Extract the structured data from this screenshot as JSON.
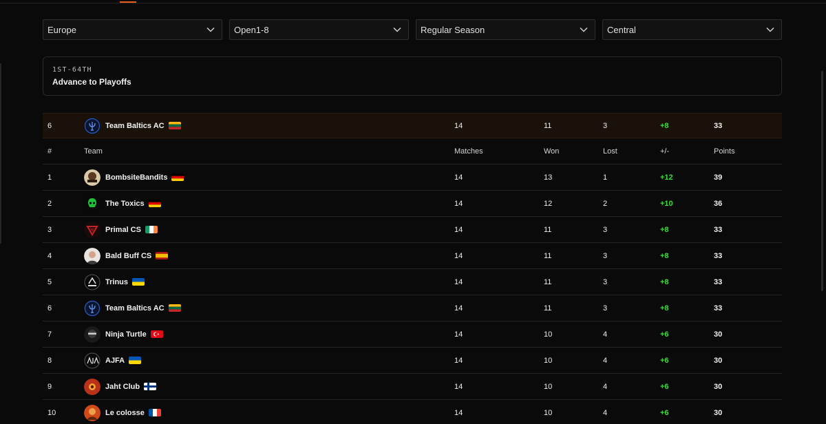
{
  "filters": {
    "region": "Europe",
    "division": "Open1-8",
    "season_phase": "Regular Season",
    "conference": "Central"
  },
  "stage": {
    "range": "1ST-64TH",
    "title": "Advance to Playoffs"
  },
  "table": {
    "headers": {
      "rank": "#",
      "team": "Team",
      "matches": "Matches",
      "won": "Won",
      "lost": "Lost",
      "diff": "+/-",
      "points": "Points"
    },
    "own_team": {
      "rank": "6",
      "team": "Team Baltics AC",
      "flag": "lithuania",
      "logo": "trident-logo",
      "matches": "14",
      "won": "11",
      "lost": "3",
      "diff": "+8",
      "points": "33"
    },
    "rows": [
      {
        "rank": "1",
        "team": "BombsiteBandits",
        "flag": "germany",
        "logo": "bombsite-bandits-logo",
        "matches": "14",
        "won": "13",
        "lost": "1",
        "diff": "+12",
        "points": "39"
      },
      {
        "rank": "2",
        "team": "The Toxics",
        "flag": "germany",
        "logo": "toxic-skull-logo",
        "matches": "14",
        "won": "12",
        "lost": "2",
        "diff": "+10",
        "points": "36"
      },
      {
        "rank": "3",
        "team": "Primal CS",
        "flag": "ireland",
        "logo": "primal-logo",
        "matches": "14",
        "won": "11",
        "lost": "3",
        "diff": "+8",
        "points": "33"
      },
      {
        "rank": "4",
        "team": "Bald Buff CS",
        "flag": "spain",
        "logo": "bald-man-logo",
        "matches": "14",
        "won": "11",
        "lost": "3",
        "diff": "+8",
        "points": "33"
      },
      {
        "rank": "5",
        "team": "Trinus",
        "flag": "ukraine",
        "logo": "trinus-logo",
        "matches": "14",
        "won": "11",
        "lost": "3",
        "diff": "+8",
        "points": "33"
      },
      {
        "rank": "6",
        "team": "Team Baltics AC",
        "flag": "lithuania",
        "logo": "trident-logo",
        "matches": "14",
        "won": "11",
        "lost": "3",
        "diff": "+8",
        "points": "33"
      },
      {
        "rank": "7",
        "team": "Ninja Turtle",
        "flag": "turkey",
        "logo": "ninja-logo",
        "matches": "14",
        "won": "10",
        "lost": "4",
        "diff": "+6",
        "points": "30"
      },
      {
        "rank": "8",
        "team": "AJFA",
        "flag": "ukraine",
        "logo": "ajfa-logo",
        "matches": "14",
        "won": "10",
        "lost": "4",
        "diff": "+6",
        "points": "30"
      },
      {
        "rank": "9",
        "team": "Jaht Club",
        "flag": "finland",
        "logo": "sun-emblem-logo",
        "matches": "14",
        "won": "10",
        "lost": "4",
        "diff": "+6",
        "points": "30"
      },
      {
        "rank": "10",
        "team": "Le colosse",
        "flag": "france",
        "logo": "colosse-logo",
        "matches": "14",
        "won": "10",
        "lost": "4",
        "diff": "+6",
        "points": "30"
      }
    ]
  },
  "colors": {
    "accent": "#e85d1a",
    "positive": "#3ddc3d",
    "highlight_row": "#1a1209",
    "background": "#0a0a0a"
  }
}
